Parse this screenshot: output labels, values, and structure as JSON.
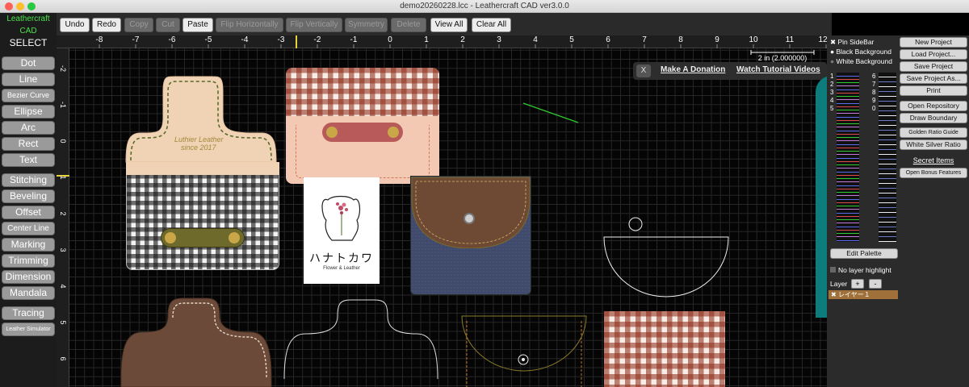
{
  "window": {
    "title": "demo20260228.lcc - Leathercraft CAD ver3.0.0"
  },
  "sidebar": {
    "app_name_1": "Leathercraft",
    "app_name_2": "CAD",
    "mode": "SELECT",
    "tools": [
      "Dot",
      "Line",
      "Bezier Curve",
      "Ellipse",
      "Arc",
      "Rect",
      "Text",
      "Stitching",
      "Beveling",
      "Offset",
      "Center Line",
      "Marking",
      "Trimming",
      "Dimension",
      "Mandala",
      "Tracing",
      "Leather Simulator"
    ]
  },
  "toolbar": {
    "buttons": [
      "Undo",
      "Redo",
      "Copy",
      "Cut",
      "Paste",
      "Flip Horizontally",
      "Flip Vertically",
      "Symmetry",
      "Delete",
      "View All",
      "Clear All"
    ]
  },
  "ruler": {
    "x_ticks": [
      "-8",
      "-7",
      "-6",
      "-5",
      "-4",
      "-3",
      "-2",
      "-1",
      "0",
      "1",
      "2",
      "3",
      "4",
      "5",
      "6",
      "7",
      "8",
      "9",
      "10",
      "11",
      "12"
    ],
    "y_ticks": [
      "-2",
      "-1",
      "0",
      "1",
      "2",
      "3",
      "4",
      "5",
      "6"
    ]
  },
  "canvas": {
    "scale_label": "2 in (2.000000)",
    "donation": {
      "close": "X",
      "donate": "Make A Donation",
      "tutorial": "Watch Tutorial Videos"
    },
    "logo_text": "Luthier Leather",
    "logo_year": "since 2017",
    "card_kana": "ハナトカワ",
    "card_sub": "Flower & Leather"
  },
  "right_panel": {
    "options": [
      "Pin SideBar",
      "Black Background",
      "White Background"
    ],
    "buttons": [
      "New Project",
      "Load Project...",
      "Save Project",
      "Save Project As...",
      "Print",
      "Open Repository",
      "Draw Boundary",
      "Golden Ratio Guide",
      "White Silver Ratio",
      "Secret Items",
      "Open Bonus Features"
    ],
    "palette_left": [
      "1",
      "2",
      "3",
      "4",
      "5"
    ],
    "palette_right": [
      "6",
      "7",
      "8",
      "9",
      "0"
    ],
    "edit_palette": "Edit Palette",
    "no_layer_highlight": "No layer highlight",
    "layer_label": "Layer",
    "layer_add": "+",
    "layer_remove": "-",
    "layer_name": "レイヤー１"
  },
  "colors": {
    "accent_green": "#47e447",
    "layer_highlight": "#a0703a"
  }
}
